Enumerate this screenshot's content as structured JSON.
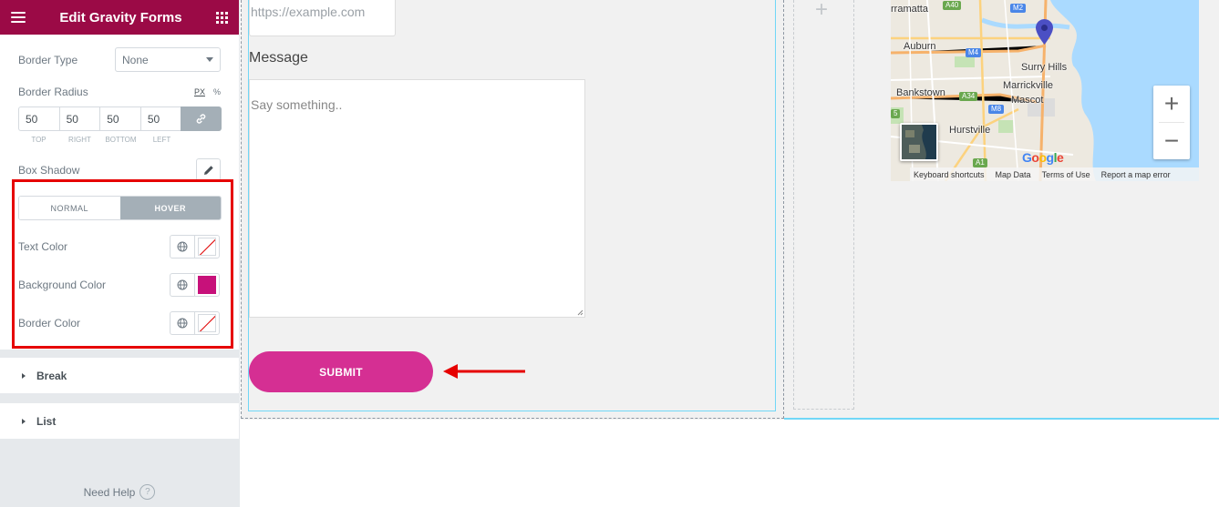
{
  "sidebar": {
    "title": "Edit Gravity Forms",
    "border_type_label": "Border Type",
    "border_type_value": "None",
    "border_radius_label": "Border Radius",
    "unit_px": "PX",
    "unit_percent": "%",
    "radius_values": [
      "50",
      "50",
      "50",
      "50"
    ],
    "radius_labels": [
      "TOP",
      "RIGHT",
      "BOTTOM",
      "LEFT"
    ],
    "box_shadow_label": "Box Shadow",
    "tab_normal": "NORMAL",
    "tab_hover": "HOVER",
    "text_color_label": "Text Color",
    "background_color_label": "Background Color",
    "background_color_value": "#c7117a",
    "border_color_label": "Border Color",
    "section_break": "Break",
    "section_list": "List",
    "need_help": "Need Help",
    "header_color": "#9b0a46"
  },
  "preview": {
    "website_placeholder": "https://example.com",
    "message_label": "Message",
    "message_placeholder": "Say something..",
    "submit_label": "SUBMIT",
    "submit_color": "#d52f93"
  },
  "map": {
    "labels": {
      "parramatta": "rramatta",
      "auburn": "Auburn",
      "surry_hills": "Surry Hills",
      "bankstown": "Bankstown",
      "marrickville": "Marrickville",
      "mascot": "Mascot",
      "hurstville": "Hurstville"
    },
    "roads": {
      "a40": "A40",
      "m2": "M2",
      "m4": "M4",
      "a34": "A34",
      "m8": "M8",
      "m5": "5",
      "a1": "A1"
    },
    "footer": {
      "keyboard": "Keyboard shortcuts",
      "map_data": "Map Data",
      "terms": "Terms of Use",
      "report": "Report a map error"
    },
    "google": "Google",
    "zoom_in": "+",
    "zoom_out": "−"
  }
}
